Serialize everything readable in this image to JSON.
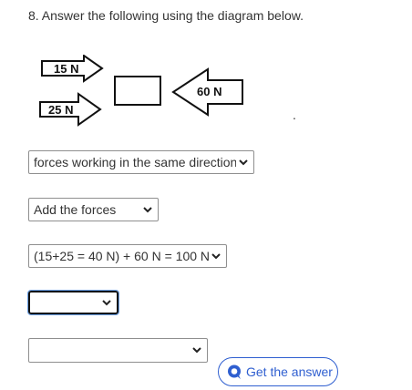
{
  "question": {
    "text": "8.  Answer the following using the diagram below."
  },
  "diagram": {
    "arrow_top_label": "15 N",
    "arrow_bottom_label": "25 N",
    "arrow_left_label": "60 N",
    "stray_mark": "."
  },
  "dropdowns": [
    {
      "selected": "forces working in the same direction"
    },
    {
      "selected": "Add the forces"
    },
    {
      "selected": "(15+25 = 40 N) + 60 N = 100 N"
    },
    {
      "selected": ""
    },
    {
      "selected": ""
    }
  ],
  "get_answer": {
    "label": "Get the answer",
    "icon": "speech-bubble-icon",
    "color": "#2f5fd0"
  }
}
